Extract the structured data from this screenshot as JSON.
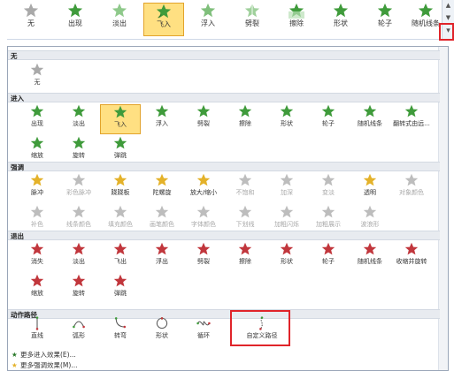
{
  "colors": {
    "entrance": "#3f9b3b",
    "emphasis_gold": "#e4b22a",
    "disabled": "#bdbdbd",
    "exit": "#c1363c",
    "selected_bg": "#ffe082",
    "highlight": "#e0242a"
  },
  "ribbon": {
    "items": [
      {
        "label": "无",
        "icon": "star-gray"
      },
      {
        "label": "出现",
        "icon": "star-green"
      },
      {
        "label": "淡出",
        "icon": "star-green-fade"
      },
      {
        "label": "飞入",
        "icon": "star-green-fly",
        "selected": true
      },
      {
        "label": "浮入",
        "icon": "star-green-float"
      },
      {
        "label": "劈裂",
        "icon": "star-green-split"
      },
      {
        "label": "擦除",
        "icon": "star-green-wipe"
      },
      {
        "label": "形状",
        "icon": "star-green"
      },
      {
        "label": "轮子",
        "icon": "star-green-wheel"
      },
      {
        "label": "随机线条",
        "icon": "star-green-lines"
      }
    ],
    "scroll_up": "▲",
    "scroll_down": "▼",
    "more": "▾"
  },
  "sections": {
    "none": {
      "title": "无",
      "items": [
        {
          "label": "无"
        }
      ]
    },
    "entrance": {
      "title": "进入",
      "items": [
        {
          "label": "出现"
        },
        {
          "label": "淡出"
        },
        {
          "label": "飞入",
          "selected": true
        },
        {
          "label": "浮入"
        },
        {
          "label": "劈裂"
        },
        {
          "label": "擦除"
        },
        {
          "label": "形状"
        },
        {
          "label": "轮子"
        },
        {
          "label": "随机线条"
        },
        {
          "label": "翻转式由远..."
        },
        {
          "label": "缩放"
        },
        {
          "label": "旋转"
        },
        {
          "label": "弹跳"
        }
      ]
    },
    "emphasis": {
      "title": "强调",
      "items": [
        {
          "label": "脉冲"
        },
        {
          "label": "彩色脉冲",
          "disabled": true
        },
        {
          "label": "跷跷板"
        },
        {
          "label": "陀螺旋"
        },
        {
          "label": "放大/缩小"
        },
        {
          "label": "不饱和",
          "disabled": true
        },
        {
          "label": "加深",
          "disabled": true
        },
        {
          "label": "变淡",
          "disabled": true
        },
        {
          "label": "透明"
        },
        {
          "label": "对象颜色",
          "disabled": true
        },
        {
          "label": "补色",
          "disabled": true
        },
        {
          "label": "线条颜色",
          "disabled": true
        },
        {
          "label": "填充颜色",
          "disabled": true
        },
        {
          "label": "画笔颜色",
          "disabled": true
        },
        {
          "label": "字体颜色",
          "disabled": true
        },
        {
          "label": "下划线",
          "disabled": true
        },
        {
          "label": "加粗闪烁",
          "disabled": true
        },
        {
          "label": "加粗展示",
          "disabled": true
        },
        {
          "label": "波浪形",
          "disabled": true
        }
      ]
    },
    "exit": {
      "title": "退出",
      "items": [
        {
          "label": "消失"
        },
        {
          "label": "淡出"
        },
        {
          "label": "飞出"
        },
        {
          "label": "浮出"
        },
        {
          "label": "劈裂"
        },
        {
          "label": "擦除"
        },
        {
          "label": "形状"
        },
        {
          "label": "轮子"
        },
        {
          "label": "随机线条"
        },
        {
          "label": "收缩并旋转"
        },
        {
          "label": "缩放"
        },
        {
          "label": "旋转"
        },
        {
          "label": "弹跳"
        }
      ]
    },
    "motion": {
      "title": "动作路径",
      "items": [
        {
          "label": "直线"
        },
        {
          "label": "弧形"
        },
        {
          "label": "转弯"
        },
        {
          "label": "形状"
        },
        {
          "label": "循环"
        },
        {
          "label": "自定义路径"
        }
      ]
    }
  },
  "footer": [
    {
      "label": "更多进入效果(E)..."
    },
    {
      "label": "更多强调效果(M)..."
    }
  ]
}
